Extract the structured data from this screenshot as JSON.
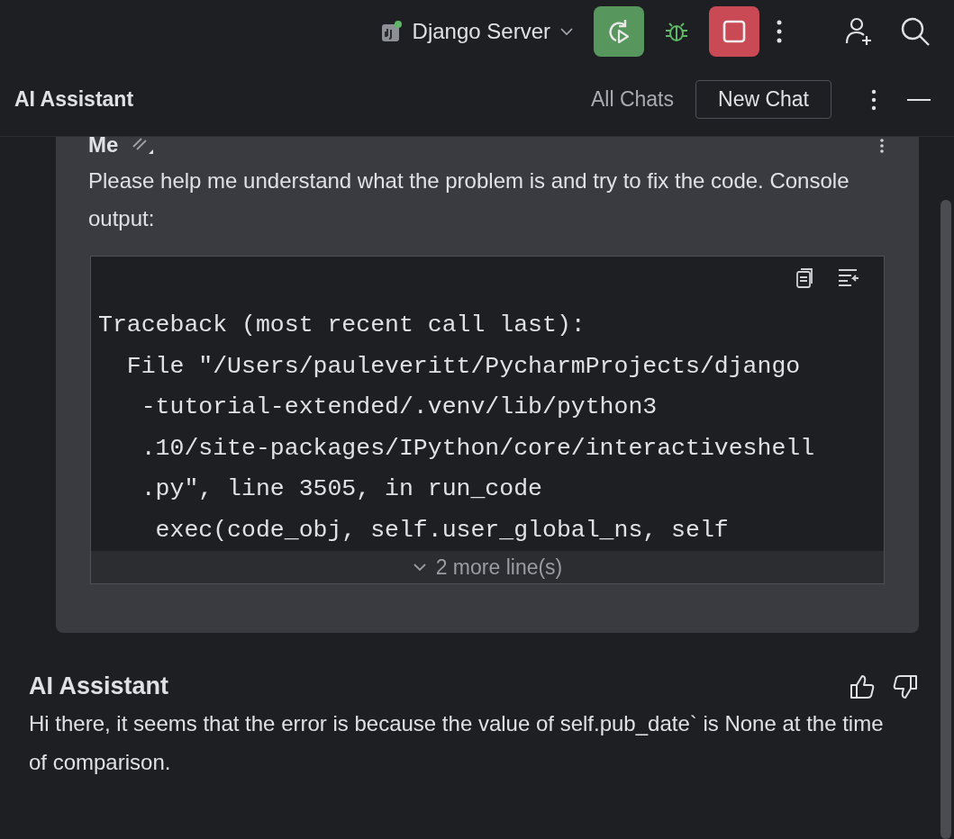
{
  "toolbar": {
    "run_config": "Django Server"
  },
  "tool_window": {
    "title": "AI Assistant",
    "all_chats": "All Chats",
    "new_chat": "New Chat"
  },
  "user_message": {
    "author": "Me",
    "text": "Please help me understand what the problem is and try to fix the code. Console output:",
    "code_lines": [
      "Traceback (most recent call last):",
      "  File \"/Users/pauleveritt/PycharmProjects/django",
      "   -tutorial-extended/.venv/lib/python3",
      "   .10/site-packages/IPython/core/interactiveshell",
      "   .py\", line 3505, in run_code",
      "    exec(code_obj, self.user_global_ns, self"
    ],
    "more_lines": "2 more line(s)"
  },
  "assistant_message": {
    "author": "AI Assistant",
    "text": "Hi there, it seems that the error is because the value of self.pub_date` is None at the time of comparison."
  }
}
